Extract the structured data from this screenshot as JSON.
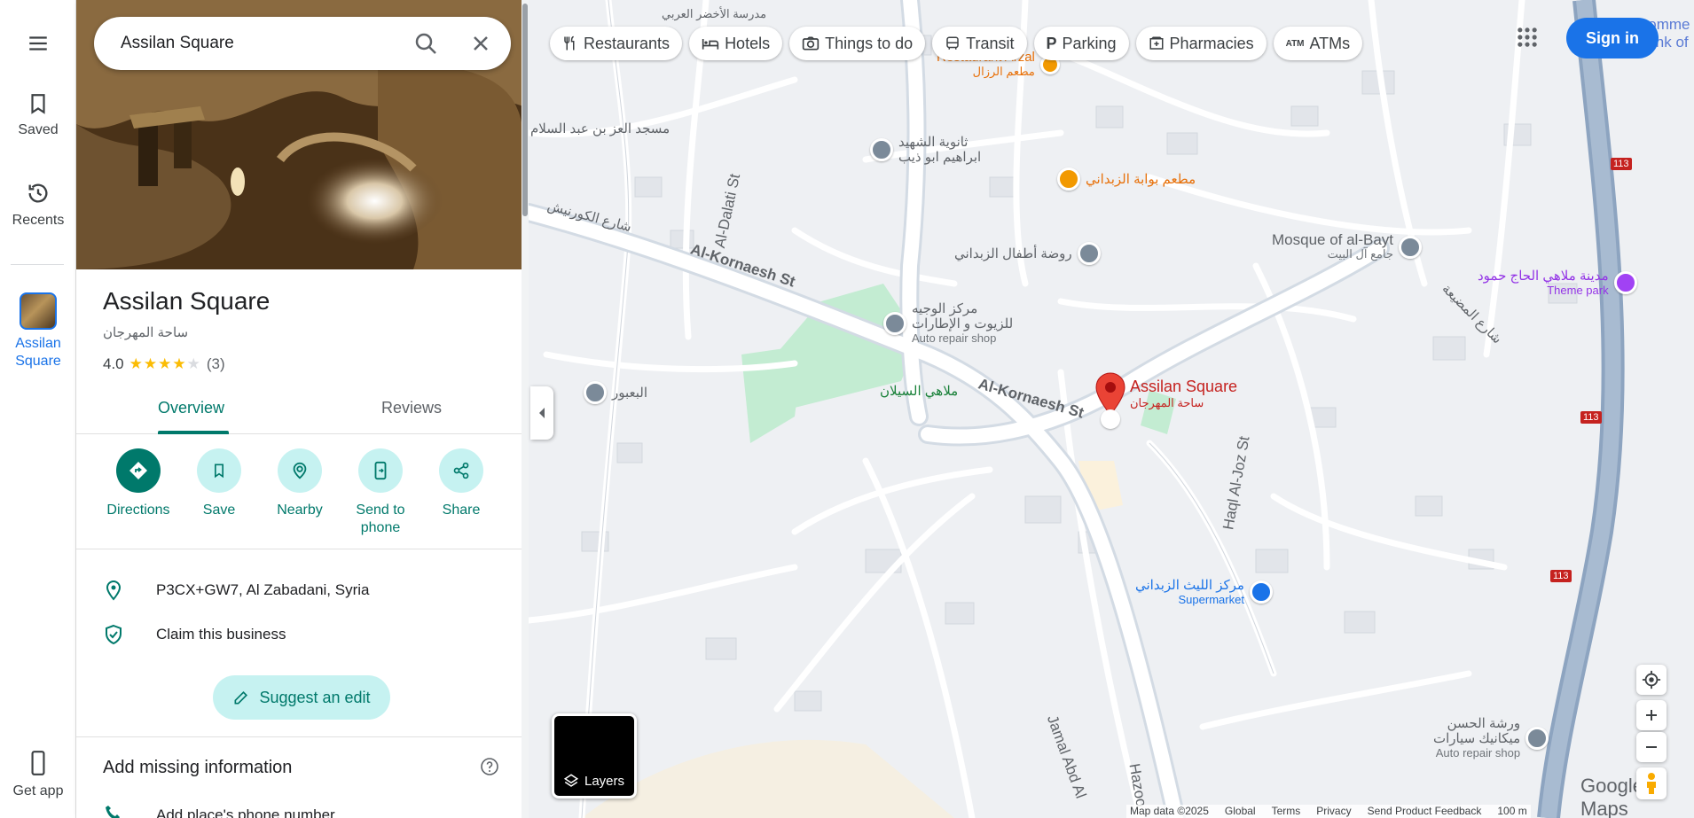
{
  "rail": {
    "saved": "Saved",
    "recents": "Recents",
    "place_line1": "Assilan",
    "place_line2": "Square",
    "get_app": "Get app"
  },
  "search": {
    "value": "Assilan Square"
  },
  "place": {
    "name": "Assilan Square",
    "name_ar": "ساحة المهرجان",
    "rating": "4.0",
    "review_count": "(3)",
    "stars_filled": 4
  },
  "tabs": {
    "overview": "Overview",
    "reviews": "Reviews"
  },
  "actions": {
    "directions": "Directions",
    "save": "Save",
    "nearby": "Nearby",
    "send_line1": "Send to",
    "send_line2": "phone",
    "share": "Share"
  },
  "info": {
    "address": "P3CX+GW7, Al Zabadani, Syria",
    "claim": "Claim this business",
    "suggest": "Suggest an edit",
    "missing_title": "Add missing information",
    "add_phone": "Add place's phone number"
  },
  "chips": [
    "Restaurants",
    "Hotels",
    "Things to do",
    "Transit",
    "Parking",
    "Pharmacies",
    "ATMs"
  ],
  "signin": "Sign in",
  "layers": "Layers",
  "map": {
    "roads": {
      "kornaesh1": "Al-Kornaesh St",
      "kornaesh2": "Al-Kornaesh St",
      "dalati": "Al-Dalati St",
      "haqlaljoz": "Haql Al-Joz St",
      "jamal": "Jamal Abd Al",
      "hazoo": "Hazoo"
    },
    "labels": {
      "top_school": "مدرسة الأخضر العربي",
      "mosque_ezz": "مسجد العز بن عبد السلام",
      "restaurant_top": "Restaurant Arzal",
      "restaurant_top_ar": "مطعم الرزال",
      "school_poi": "ثانوية الشهيد",
      "school_poi2": "ابراهيم ابو ذيب",
      "rest_gate": "مطعم بوابة الزبداني",
      "kinder": "روضة أطفال الزبداني",
      "mosque": "Mosque of al-Bayt",
      "mosque_ar": "جامع آل البيت",
      "theme_ar": "مدينة ملاهي الحاج حمود",
      "theme": "Theme park",
      "auto1_ar1": "مركز الوجيه",
      "auto1_ar2": "للزيوت و الإطارات",
      "auto1": "Auto repair shop",
      "park": "ملاهي السيلان",
      "baaour": "البعبور",
      "pin": "Assilan Square",
      "pin_ar": "ساحة المهرجان",
      "market_ar": "مركز الليث الزبداني",
      "market": "Supermarket",
      "workshop_ar1": "ورشة الحسن",
      "workshop_ar2": "ميكانيك سيارات",
      "workshop": "Auto repair shop",
      "route113": "113",
      "commercial1": "Comme",
      "commercial2": "Bank of",
      "arabic_road1": "شارع الكورنيش",
      "arabic_road2": "شارع المضيعة"
    }
  },
  "brand": "Google Maps",
  "footer": [
    "Map data ©2025",
    "Global",
    "Terms",
    "Privacy",
    "Send Product Feedback",
    "100 m"
  ],
  "colors": {
    "accent": "#00796b",
    "signin": "#1a73e8",
    "pin": "#ea4335",
    "highway": "#8da4c0",
    "park": "#c3ecd2"
  }
}
